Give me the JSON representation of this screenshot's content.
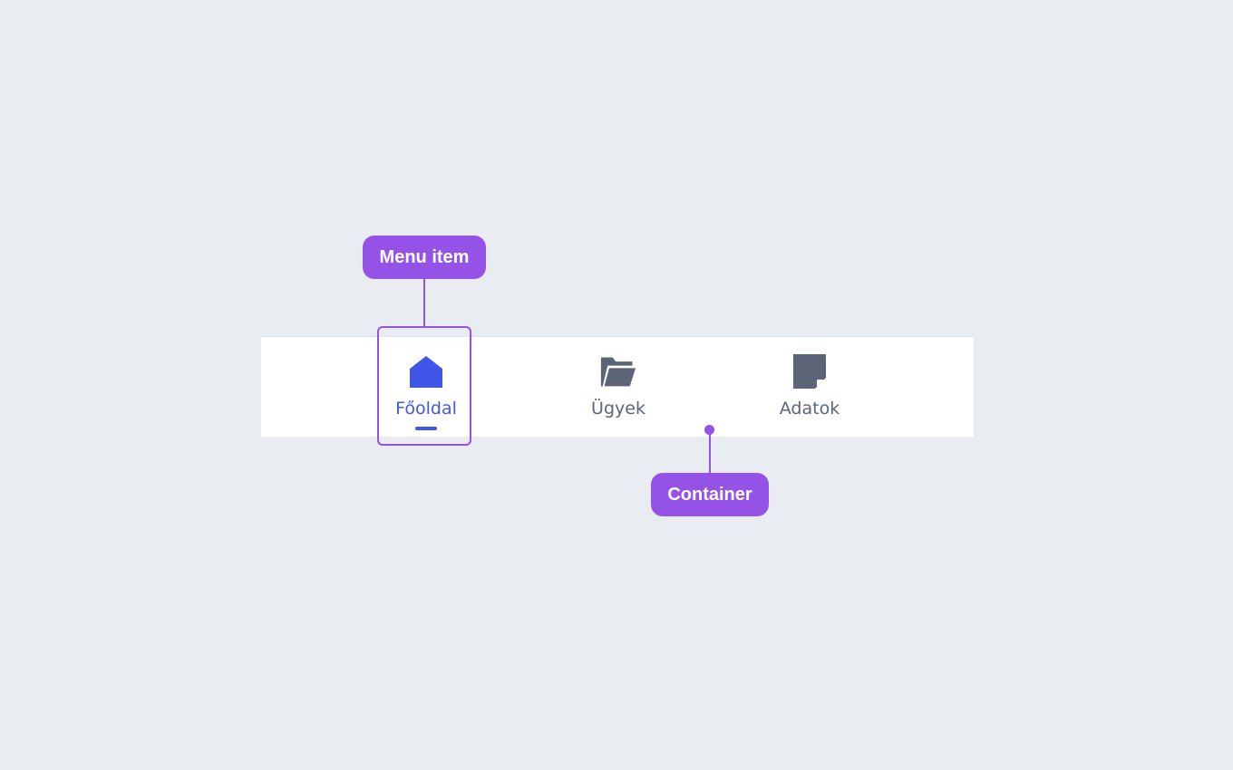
{
  "nav": {
    "items": [
      {
        "label": "Főoldal",
        "icon": "home-icon",
        "active": true
      },
      {
        "label": "Ügyek",
        "icon": "folder-open-icon",
        "active": false
      },
      {
        "label": "Adatok",
        "icon": "note-icon",
        "active": false
      }
    ]
  },
  "annotations": {
    "menu_item": "Menu item",
    "container": "Container"
  },
  "colors": {
    "background": "#e9ecf1",
    "container": "#ffffff",
    "active": "#3f56e8",
    "inactive": "#5c6478",
    "annotation": "#9452e6"
  }
}
